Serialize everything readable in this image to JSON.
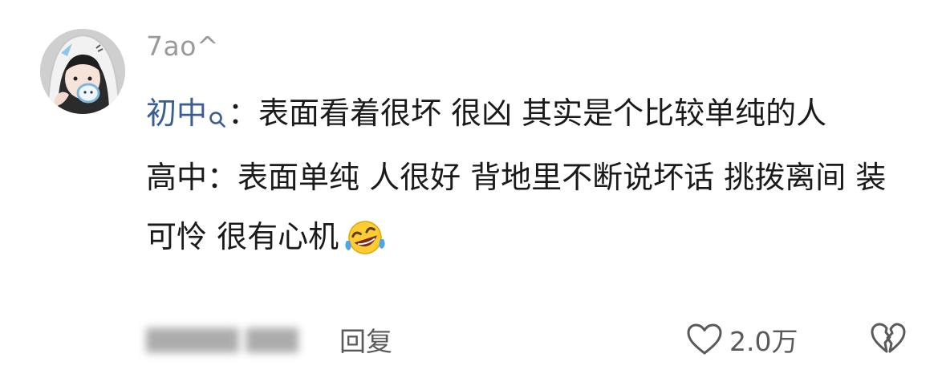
{
  "comment": {
    "avatar_icon": "user-avatar",
    "username": "7ao^",
    "paragraphs": [
      {
        "term": "初中",
        "term_icon": "search-icon",
        "text": "：表面看着很坏 很凶 其实是个比较单纯的人"
      },
      {
        "term": "高中",
        "text": "：表面单纯 人很好 背地里不断说坏话 挑拨离间 装可怜 很有心机",
        "emoji": "rolling-on-floor-laughing-emoji"
      }
    ],
    "footer": {
      "meta_blurred": "▇▇▇▇▇ ▇▇▇",
      "reply_label": "回复",
      "like_icon": "heart-icon",
      "like_count": "2.0万",
      "dislike_icon": "broken-heart-icon"
    },
    "colors": {
      "link_term": "#3b5d96",
      "username": "#9a9a9a",
      "secondary": "#5a5a5a"
    }
  }
}
